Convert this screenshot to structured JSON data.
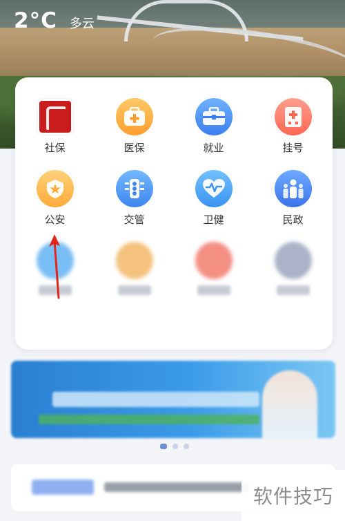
{
  "weather": {
    "temperature": "2°C",
    "condition": "多云"
  },
  "services": [
    {
      "label": "社保",
      "icon": "seal-icon"
    },
    {
      "label": "医保",
      "icon": "medical-kit-icon"
    },
    {
      "label": "就业",
      "icon": "briefcase-icon"
    },
    {
      "label": "挂号",
      "icon": "hospital-icon"
    },
    {
      "label": "公安",
      "icon": "police-badge-icon"
    },
    {
      "label": "交管",
      "icon": "traffic-light-icon"
    },
    {
      "label": "卫健",
      "icon": "heart-pulse-icon"
    },
    {
      "label": "民政",
      "icon": "people-icon"
    }
  ],
  "watermark": "软件技巧",
  "colors": {
    "accent": "#3c7ff0",
    "seal_red": "#c91d1d",
    "arrow": "#e0261a"
  }
}
